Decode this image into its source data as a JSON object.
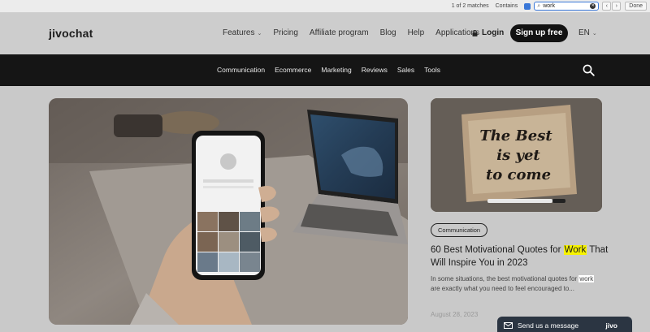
{
  "find_bar": {
    "matches": "1 of 2 matches",
    "mode": "Contains",
    "query": "work",
    "done_label": "Done",
    "prev_glyph": "‹",
    "next_glyph": "›"
  },
  "header": {
    "logo": "jivochat",
    "nav": [
      "Features",
      "Pricing",
      "Affiliate program",
      "Blog",
      "Help",
      "Applications"
    ],
    "login_label": "Login",
    "signup_label": "Sign up free",
    "language": "EN"
  },
  "categories": [
    "Communication",
    "Ecommerce",
    "Marketing",
    "Reviews",
    "Sales",
    "Tools"
  ],
  "article": {
    "badge": "Communication",
    "title_before": "60  Best Motivational Quotes for ",
    "title_highlight": "Work",
    "title_after": " That Will Inspire You in 2023",
    "excerpt_before": "In some situations, the best motivational quotes for ",
    "excerpt_highlight": "work",
    "excerpt_after": " are exactly what you need to feel encouraged to...",
    "date": "August 28, 2023",
    "image_text": [
      "The Best",
      "is yet",
      "to come"
    ]
  },
  "chat_widget": {
    "label": "Send us a message",
    "brand": "jivo"
  },
  "colors": {
    "highlight": "#f7f300",
    "dark_bar": "#151515",
    "chat": "#2b3542",
    "find_accent": "#3a78d8"
  }
}
